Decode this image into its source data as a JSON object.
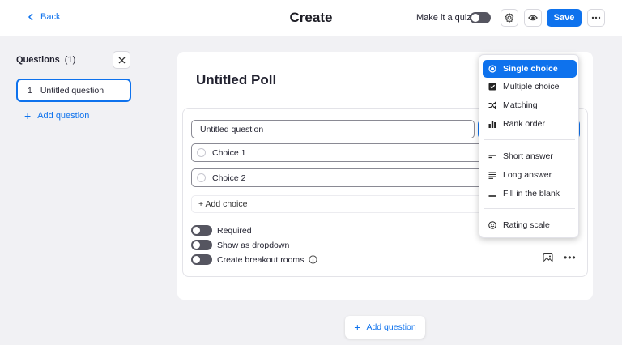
{
  "header": {
    "back_label": "Back",
    "title": "Create",
    "quiz_label": "Make it a quiz",
    "save_label": "Save"
  },
  "sidebar": {
    "heading": "Questions",
    "count": "(1)",
    "items": [
      {
        "number": "1",
        "label": "Untitled question"
      }
    ],
    "add_label": "Add question"
  },
  "main": {
    "poll_title": "Untitled Poll",
    "question_value": "Untitled question",
    "choices": [
      {
        "label": "Choice 1"
      },
      {
        "label": "Choice 2"
      }
    ],
    "add_choice_label": "+ Add choice",
    "options": [
      {
        "label": "Required"
      },
      {
        "label": "Show as dropdown"
      },
      {
        "label": "Create breakout rooms"
      }
    ],
    "add_question_label": "Add question"
  },
  "type_menu": {
    "items": [
      {
        "label": "Single choice",
        "icon": "radio-selected-icon",
        "active": true
      },
      {
        "label": "Multiple choice",
        "icon": "checkbox-checked-icon"
      },
      {
        "label": "Matching",
        "icon": "shuffle-icon"
      },
      {
        "label": "Rank order",
        "icon": "bar-chart-icon"
      },
      {
        "label": "Short answer",
        "icon": "short-lines-icon"
      },
      {
        "label": "Long answer",
        "icon": "long-lines-icon"
      },
      {
        "label": "Fill in the blank",
        "icon": "blank-line-icon"
      },
      {
        "label": "Rating scale",
        "icon": "smiley-icon"
      }
    ]
  },
  "colors": {
    "accent": "#0e72ed",
    "background": "#f1f1f4",
    "toggle_off": "#555560"
  }
}
